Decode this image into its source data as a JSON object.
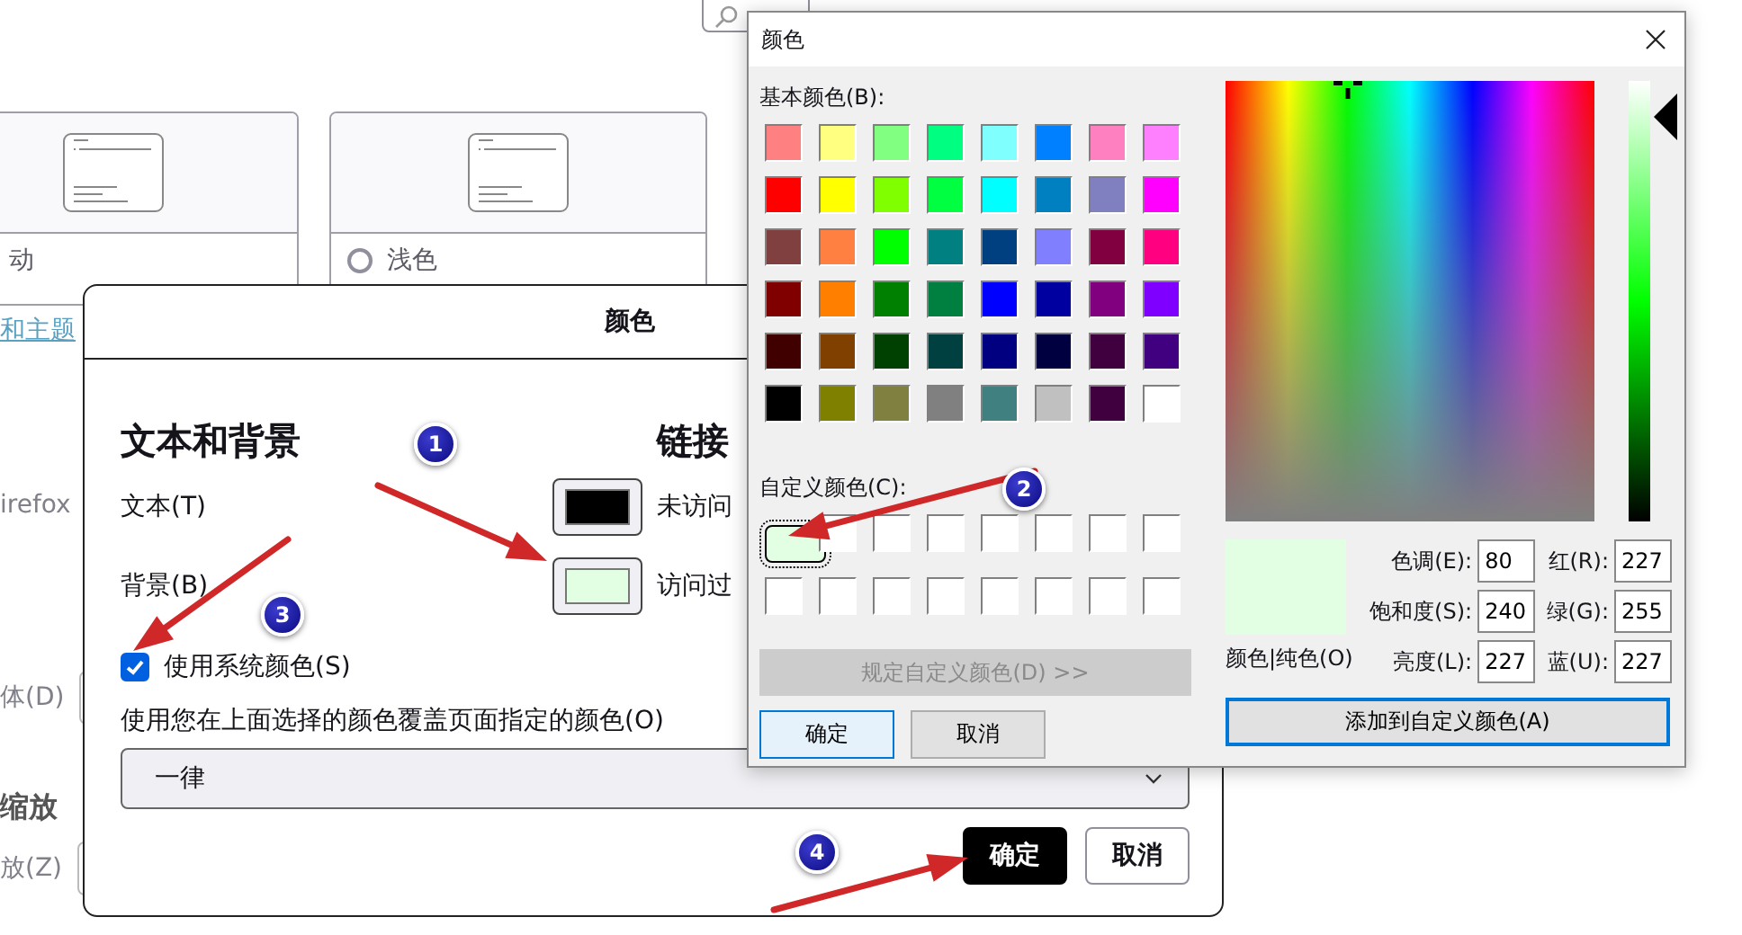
{
  "settings_page": {
    "theme_cards": [
      {
        "label": "动"
      },
      {
        "label": "浅色",
        "selected": false
      }
    ],
    "link": "和主题",
    "firefox_fragment": "irefox",
    "font_label": "体(D)",
    "zoom_heading": "缩放",
    "zoom_label": "放(Z)"
  },
  "colors_dialog": {
    "title": "颜色",
    "section_title": "文本和背景",
    "links_title": "链接",
    "rows": [
      {
        "label": "文本(T)",
        "color": "#000000",
        "link_label": "未访问"
      },
      {
        "label": "背景(B)",
        "color": "#e3ffe3",
        "link_label": "访问过"
      }
    ],
    "system_colors": {
      "label": "使用系统颜色(S)",
      "checked": true
    },
    "override_label": "使用您在上面选择的颜色覆盖页面指定的颜色(O)",
    "override_select": {
      "value": "一律"
    },
    "buttons": [
      {
        "label": "确定",
        "kind": "primary"
      },
      {
        "label": "取消",
        "kind": "secondary"
      }
    ]
  },
  "color_picker": {
    "title": "颜色",
    "basic_label": "基本颜色(B):",
    "basic_colors": [
      {
        "color": "#ff8080"
      },
      {
        "color": "#ffff80"
      },
      {
        "color": "#80ff80"
      },
      {
        "color": "#00ff80"
      },
      {
        "color": "#80ffff"
      },
      {
        "color": "#0080ff"
      },
      {
        "color": "#ff80c0"
      },
      {
        "color": "#ff80ff"
      },
      {
        "color": "#ff0000"
      },
      {
        "color": "#ffff00"
      },
      {
        "color": "#80ff00"
      },
      {
        "color": "#00ff40"
      },
      {
        "color": "#00ffff"
      },
      {
        "color": "#0080c0"
      },
      {
        "color": "#8080c0"
      },
      {
        "color": "#ff00ff"
      },
      {
        "color": "#804040"
      },
      {
        "color": "#ff8040"
      },
      {
        "color": "#00ff00"
      },
      {
        "color": "#008080"
      },
      {
        "color": "#004080"
      },
      {
        "color": "#8080ff"
      },
      {
        "color": "#800040"
      },
      {
        "color": "#ff0080"
      },
      {
        "color": "#800000"
      },
      {
        "color": "#ff8000"
      },
      {
        "color": "#008000"
      },
      {
        "color": "#008040"
      },
      {
        "color": "#0000ff"
      },
      {
        "color": "#0000a0"
      },
      {
        "color": "#800080"
      },
      {
        "color": "#8000ff"
      },
      {
        "color": "#400000"
      },
      {
        "color": "#804000"
      },
      {
        "color": "#004000"
      },
      {
        "color": "#004040"
      },
      {
        "color": "#000080"
      },
      {
        "color": "#000040"
      },
      {
        "color": "#400040"
      },
      {
        "color": "#400080"
      },
      {
        "color": "#000000"
      },
      {
        "color": "#808000"
      },
      {
        "color": "#808040"
      },
      {
        "color": "#808080"
      },
      {
        "color": "#408080"
      },
      {
        "color": "#c0c0c0"
      },
      {
        "color": "#400040"
      },
      {
        "color": "#ffffff"
      }
    ],
    "custom_label": "自定义颜色(C):",
    "custom_colors": [
      {
        "color": "#e3ffe3",
        "selected": true
      },
      {
        "color": "#ffffff",
        "selected": false
      },
      {
        "color": "#ffffff",
        "selected": false
      },
      {
        "color": "#ffffff",
        "selected": false
      },
      {
        "color": "#ffffff",
        "selected": false
      },
      {
        "color": "#ffffff",
        "selected": false
      },
      {
        "color": "#ffffff",
        "selected": false
      },
      {
        "color": "#ffffff",
        "selected": false
      },
      {
        "color": "#ffffff",
        "selected": false
      },
      {
        "color": "#ffffff",
        "selected": false
      },
      {
        "color": "#ffffff",
        "selected": false
      },
      {
        "color": "#ffffff",
        "selected": false
      },
      {
        "color": "#ffffff",
        "selected": false
      },
      {
        "color": "#ffffff",
        "selected": false
      },
      {
        "color": "#ffffff",
        "selected": false
      },
      {
        "color": "#ffffff",
        "selected": false
      }
    ],
    "define_button": {
      "label": "规定自定义颜色(D) >>",
      "disabled": true
    },
    "buttons": [
      {
        "label": "确定",
        "kind": "default"
      },
      {
        "label": "取消",
        "kind": "normal"
      }
    ],
    "luminance": {
      "level": 0.95
    },
    "preview": {
      "color": "#e3ffe3",
      "label": "颜色|纯色(O)"
    },
    "fields": [
      {
        "label": "色调(E):",
        "value": "80"
      },
      {
        "label": "红(R):",
        "value": "227"
      },
      {
        "label": "饱和度(S):",
        "value": "240"
      },
      {
        "label": "绿(G):",
        "value": "255"
      },
      {
        "label": "亮度(L):",
        "value": "227"
      },
      {
        "label": "蓝(U):",
        "value": "227"
      }
    ],
    "add_button": "添加到自定义颜色(A)"
  },
  "annotations": [
    {
      "number": "1"
    },
    {
      "number": "2"
    },
    {
      "number": "3"
    },
    {
      "number": "4"
    }
  ]
}
